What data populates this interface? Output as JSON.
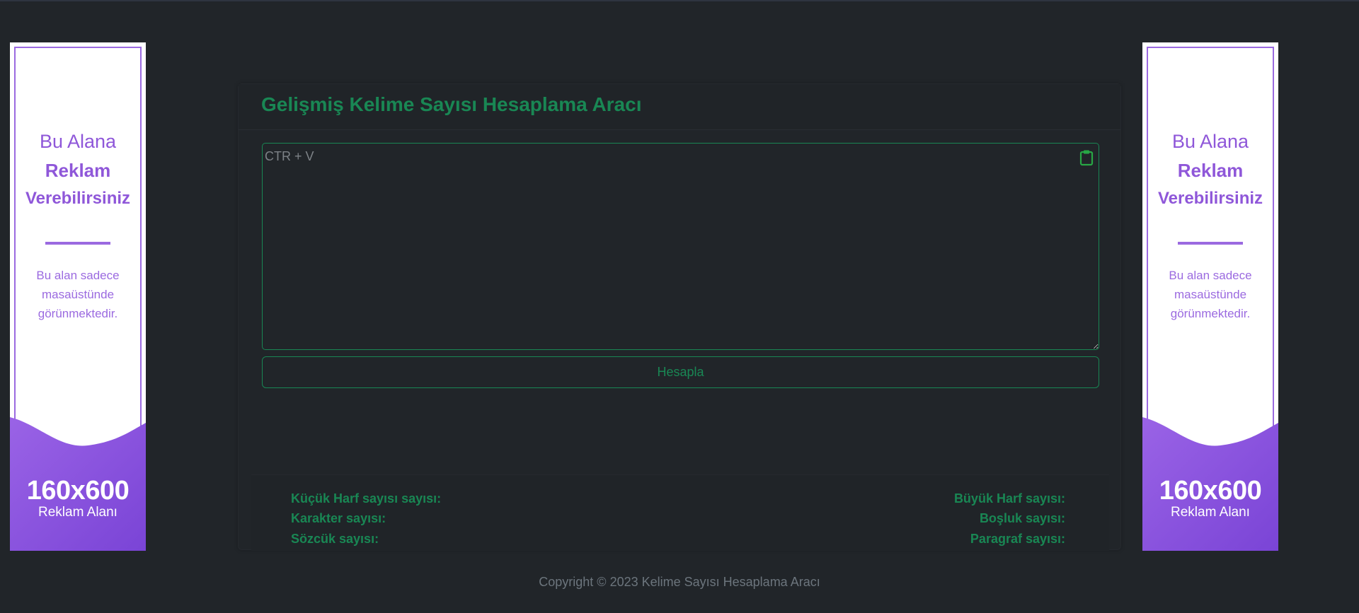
{
  "ads": {
    "left": {
      "line1": "Bu Alana",
      "line2": "Reklam",
      "line3": "Verebilirsiniz",
      "description": "Bu alan sadece masaüstünde görünmektedir.",
      "size": "160x600",
      "area": "Reklam Alanı"
    },
    "right": {
      "line1": "Bu Alana",
      "line2": "Reklam",
      "line3": "Verebilirsiniz",
      "description": "Bu alan sadece masaüstünde görünmektedir.",
      "size": "160x600",
      "area": "Reklam Alanı"
    }
  },
  "main": {
    "title": "Gelişmiş Kelime Sayısı Hesaplama Aracı",
    "textarea": {
      "placeholder": "CTR + V",
      "value": ""
    },
    "paste_icon": "clipboard-icon",
    "button_label": "Hesapla",
    "stats": {
      "lowercase": "Küçük Harf sayısı sayısı:",
      "uppercase": "Büyük Harf sayısı:",
      "characters": "Karakter sayısı:",
      "spaces": "Boşluk sayısı:",
      "words": "Sözcük sayısı:",
      "paragraphs": "Paragraf sayısı:"
    }
  },
  "footer": {
    "copyright": "Copyright © 2023 Kelime Sayısı Hesaplama Aracı"
  },
  "colors": {
    "background": "#212529",
    "accent": "#198754",
    "ad_purple": "#8f57d9",
    "footer_text": "#6c757d"
  }
}
